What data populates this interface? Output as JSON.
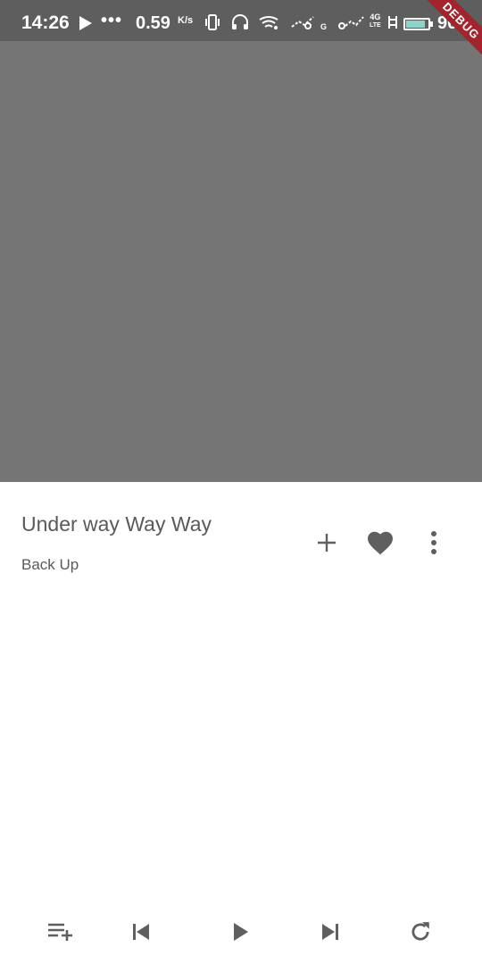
{
  "status_bar": {
    "time": "14:26",
    "speed": "0.59",
    "speed_unit": "K/s",
    "network_top": "4G",
    "network_bottom": "LTE",
    "battery_text": "90",
    "battery_level": 0.9,
    "icons": [
      "play-icon",
      "vibrate-icon",
      "headset-icon",
      "wifi-icon",
      "signal-icon",
      "signal-icon",
      "sync-icon",
      "battery-icon"
    ]
  },
  "debug_banner": "DEBUG",
  "track": {
    "title": "Under way Way Way",
    "artist": "Back Up"
  },
  "actions": [
    "add-icon",
    "heart-icon",
    "more-vert-icon"
  ],
  "controls": [
    "playlist-add-icon",
    "skip-previous-icon",
    "play-icon",
    "skip-next-icon",
    "repeat-icon"
  ],
  "colors": {
    "status_bar": "#5e5e5e",
    "artwork": "#757575",
    "text": "#5a5a5a",
    "icon": "#5f5f5f",
    "debug": "#a2252d"
  }
}
